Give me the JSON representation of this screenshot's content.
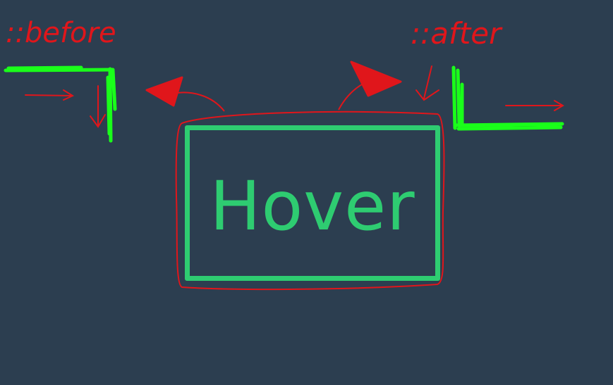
{
  "button": {
    "label": "Hover",
    "color": "#2ecc71"
  },
  "annotations": {
    "before_label": "::before",
    "after_label": "::after",
    "ink_color": "#e0161b",
    "pseudo_border_color": "#1aff1a"
  },
  "background": "#2c3e50"
}
